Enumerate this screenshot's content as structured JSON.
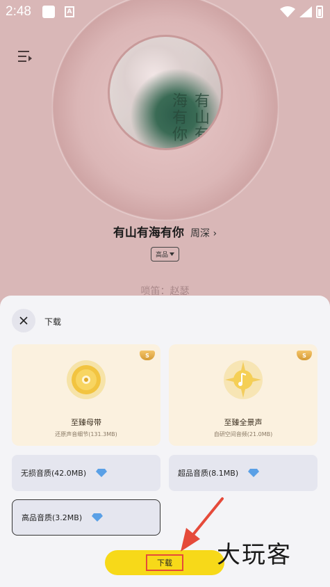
{
  "status_bar": {
    "time": "2:48",
    "app_icon_letter": "A"
  },
  "player": {
    "song_title": "有山有海有你",
    "artist": "周深",
    "artist_chevron": "›",
    "quality": "高品",
    "lyric": "唢笛：赵瑟",
    "cover_text": "有山有海有你"
  },
  "sheet": {
    "title": "下载",
    "cards": [
      {
        "name": "至臻母带",
        "desc": "还原声音细节(131.3MB)",
        "badge": "S"
      },
      {
        "name": "至臻全景声",
        "desc": "自研空间音频(21.0MB)",
        "badge": "S"
      }
    ],
    "options": [
      {
        "label": "无损音质(42.0MB)"
      },
      {
        "label": "超品音质(8.1MB)"
      },
      {
        "label": "高品音质(3.2MB)"
      }
    ],
    "download_button": "下载"
  },
  "watermark": "大玩客",
  "colors": {
    "accent_yellow": "#f7d919",
    "annotation_red": "#e54a3a",
    "card_gold": "#fbf1df",
    "option_gray": "#e5e6ef"
  }
}
